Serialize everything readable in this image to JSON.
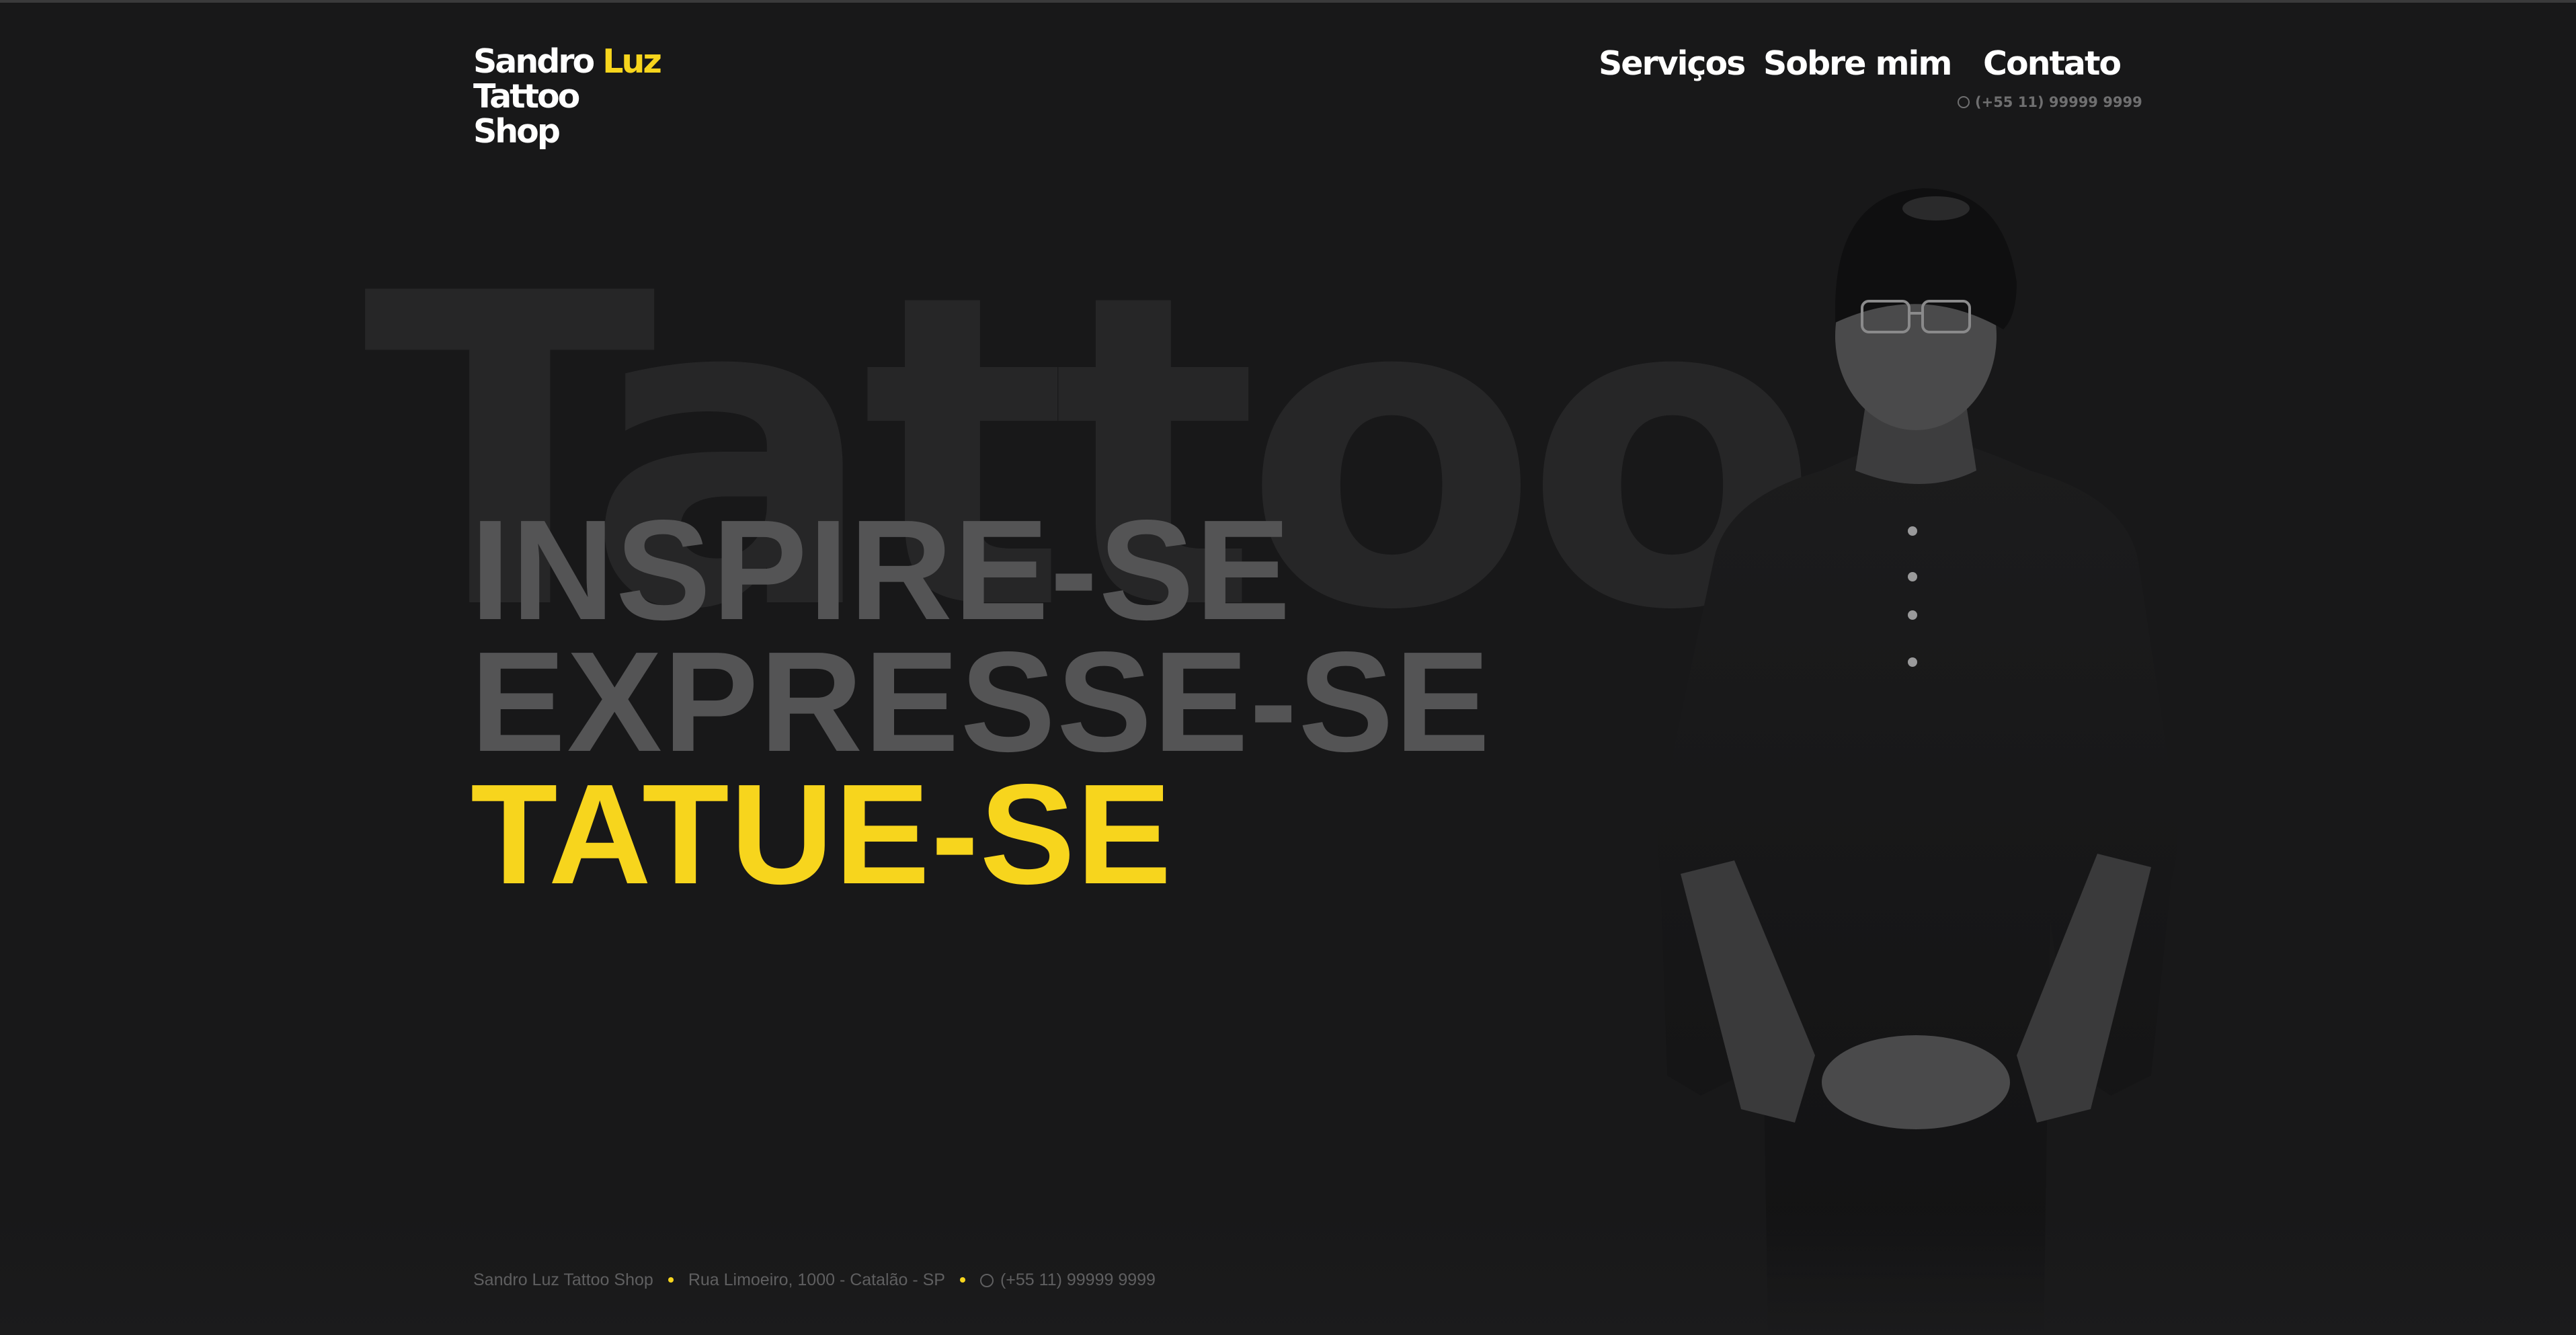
{
  "brand": {
    "line1": "Sandro",
    "line1_accent": "Luz",
    "line2": "Tattoo",
    "line3": "Shop",
    "accent_color": "#f7d51d"
  },
  "nav": {
    "items": [
      "Serviços",
      "Sobre mim",
      "Contato"
    ],
    "phone": "(+55 11) 99999 9999"
  },
  "hero": {
    "background_word": "Tattoo",
    "lines": [
      "INSPIRE-SE",
      "EXPRESSE-SE",
      "TATUE-SE"
    ]
  },
  "footer": {
    "name": "Sandro Luz Tattoo Shop",
    "address": "Rua Limoeiro, 1000 - Catalão - SP",
    "phone": "(+55 11) 99999 9999"
  },
  "colors": {
    "background": "#181819",
    "muted_text": "#545455",
    "accent": "#f7d51d"
  }
}
